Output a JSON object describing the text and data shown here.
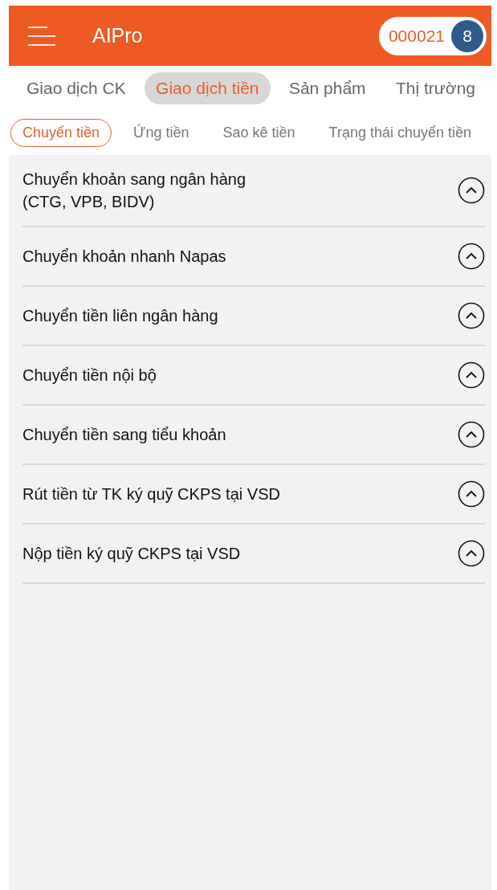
{
  "header": {
    "title": "AIPro",
    "account": "000021",
    "badge": "8"
  },
  "tabs": [
    {
      "label": "Giao dịch CK",
      "selected": false
    },
    {
      "label": "Giao dịch tiền",
      "selected": true
    },
    {
      "label": "Sản phẩm",
      "selected": false
    },
    {
      "label": "Thị trường",
      "selected": false
    }
  ],
  "subtabs": [
    {
      "label": "Chuyển tiền",
      "selected": true
    },
    {
      "label": "Ứng tiền",
      "selected": false
    },
    {
      "label": "Sao kê tiền",
      "selected": false
    },
    {
      "label": "Trạng thái chuyển tiền",
      "selected": false
    }
  ],
  "items": [
    {
      "lines": [
        "Chuyển khoản sang ngân hàng",
        "(CTG, VPB, BIDV)"
      ]
    },
    {
      "lines": [
        "Chuyển khoản nhanh Napas"
      ]
    },
    {
      "lines": [
        "Chuyển tiền liên ngân hàng"
      ]
    },
    {
      "lines": [
        "Chuyển tiền nội bộ"
      ]
    },
    {
      "lines": [
        "Chuyển tiền sang tiểu khoản"
      ]
    },
    {
      "lines": [
        "Rút tiền từ TK ký quỹ CKPS tại VSD"
      ]
    },
    {
      "lines": [
        "Nộp tiền ký quỹ CKPS tại VSD"
      ]
    }
  ]
}
